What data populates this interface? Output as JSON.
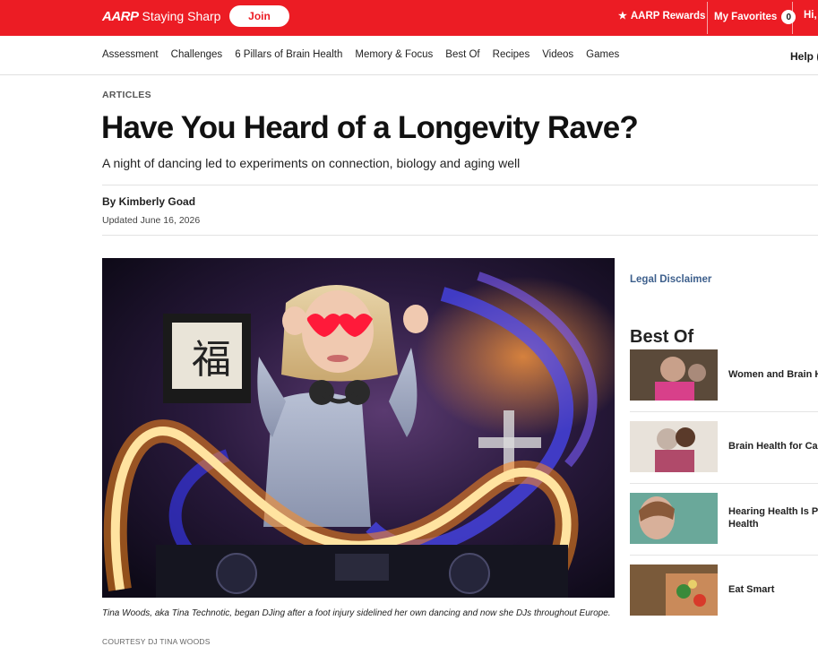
{
  "topbar": {
    "brand_mark": "AARP",
    "brand_name": "Staying Sharp",
    "join_label": "Join",
    "rewards_label": "AARP Rewards",
    "favorites_label": "My Favorites",
    "favorites_count": "0",
    "greeting": "Hi,",
    "accent_color": "#ec1c24"
  },
  "nav": {
    "items": [
      "Assessment",
      "Challenges",
      "6 Pillars of Brain Health",
      "Memory & Focus",
      "Best Of",
      "Recipes",
      "Videos",
      "Games"
    ],
    "help_label": "Help ("
  },
  "article": {
    "kicker": "ARTICLES",
    "title": "Have You Heard of a Longevity Rave?",
    "subtitle": "A night of dancing led to experiments on connection, biology and aging well",
    "byline": "By Kimberly Goad",
    "updated": "Updated June 16, 2026",
    "caption": "Tina Woods, aka Tina Technotic, began DJing after a foot injury sidelined her own dancing and now she DJs throughout Europe.",
    "credit": "COURTESY DJ TINA WOODS"
  },
  "sidebar": {
    "legal": "Legal Disclaimer",
    "best_of_title": "Best Of",
    "items": [
      {
        "label_1": "Women and Brain H",
        "label_2": ""
      },
      {
        "label_1": "Brain Health for Car",
        "label_2": ""
      },
      {
        "label_1": "Hearing Health Is Pa",
        "label_2": "Health"
      },
      {
        "label_1": "Eat Smart",
        "label_2": ""
      }
    ]
  }
}
